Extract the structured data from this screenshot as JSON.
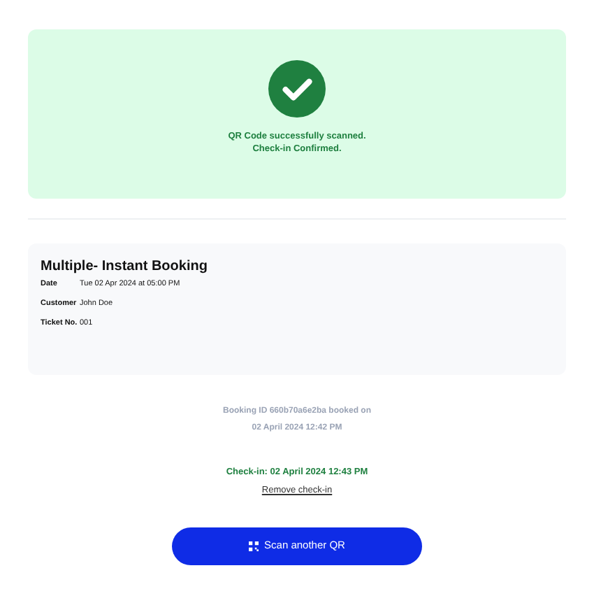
{
  "status": {
    "message_lines": [
      "QR Code successfully scanned.",
      "Check-in Confirmed."
    ]
  },
  "booking": {
    "title": "Multiple- Instant Booking",
    "rows": [
      {
        "label": "Date",
        "value": "Tue 02 Apr 2024 at 05:00 PM"
      },
      {
        "label": "Customer",
        "value": "John Doe"
      },
      {
        "label": "Ticket No.",
        "value": "001"
      }
    ]
  },
  "booked_info": [
    "Booking ID 660b70a6e2ba booked on",
    "02 April 2024 12:42 PM"
  ],
  "checkin": {
    "text": "Check-in: 02 April 2024 12:43 PM",
    "remove_link": "Remove check-in"
  },
  "scan_button": {
    "label": "Scan another QR"
  }
}
